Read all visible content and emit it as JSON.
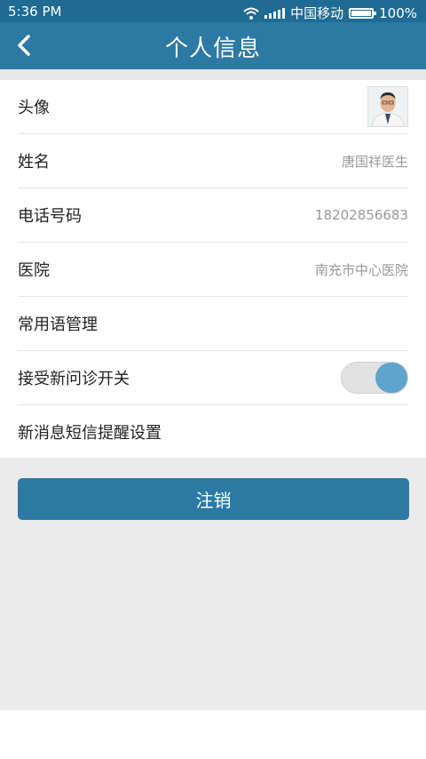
{
  "status": {
    "time": "5:36 PM",
    "carrier": "中国移动",
    "battery": "100%"
  },
  "nav": {
    "title": "个人信息"
  },
  "rows": [
    {
      "label": "头像"
    },
    {
      "label": "姓名",
      "value": "唐国祥医生"
    },
    {
      "label": "电话号码",
      "value": "18202856683"
    },
    {
      "label": "医院",
      "value": "南充市中心医院"
    },
    {
      "label": "常用语管理"
    },
    {
      "label": "接受新问诊开关",
      "toggle_on": true
    },
    {
      "label": "新消息短信提醒设置"
    }
  ],
  "logout_label": "注销",
  "colors": {
    "nav": "#2c7aa4",
    "status_bar": "#1f6b93",
    "toggle_on": "#5fa4cc"
  }
}
